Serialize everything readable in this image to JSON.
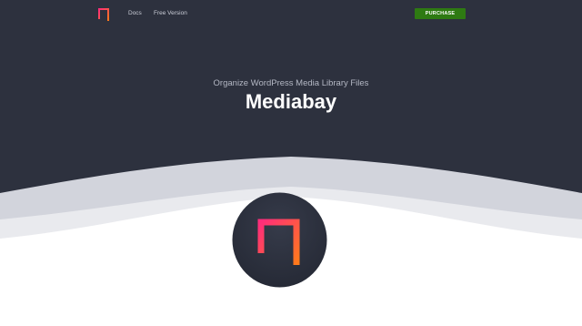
{
  "nav": {
    "links": [
      "Docs",
      "Free Version"
    ],
    "purchase_label": "PURCHASE"
  },
  "hero": {
    "tagline": "Organize WordPress Media Library Files",
    "title": "Mediabay"
  },
  "colors": {
    "hero_background": "#2d313e",
    "purchase_button": "#2e7a12",
    "logo_gradient_start": "#ff2d7a",
    "logo_gradient_end": "#ff7a1a",
    "wave_light": "#e9eaee",
    "wave_mid": "#d2d4dc"
  },
  "icons": {
    "brand_logo": "mediabay-logo-icon",
    "circle_logo": "mediabay-circle-logo-icon"
  }
}
